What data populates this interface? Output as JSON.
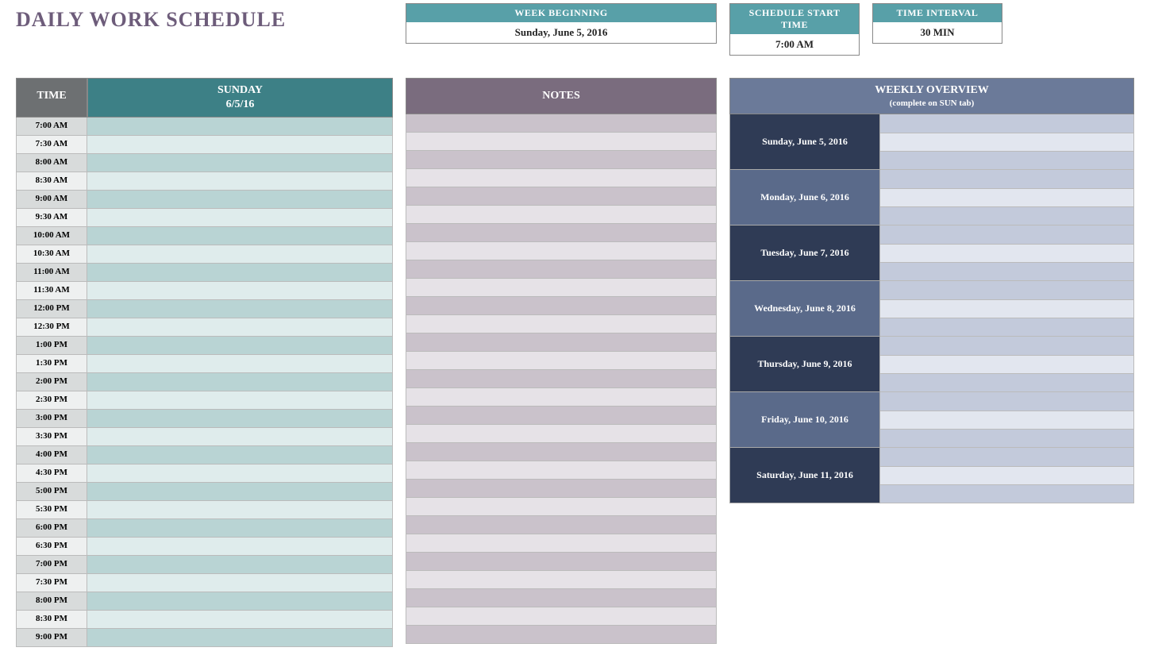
{
  "title": "DAILY WORK SCHEDULE",
  "config": {
    "week_beginning_label": "WEEK BEGINNING",
    "week_beginning_value": "Sunday, June 5, 2016",
    "start_time_label": "SCHEDULE START TIME",
    "start_time_value": "7:00 AM",
    "interval_label": "TIME INTERVAL",
    "interval_value": "30 MIN"
  },
  "schedule": {
    "time_header": "TIME",
    "day_name": "SUNDAY",
    "day_date": "6/5/16",
    "slots": [
      {
        "time": "7:00 AM",
        "event": ""
      },
      {
        "time": "7:30 AM",
        "event": ""
      },
      {
        "time": "8:00 AM",
        "event": ""
      },
      {
        "time": "8:30 AM",
        "event": ""
      },
      {
        "time": "9:00 AM",
        "event": ""
      },
      {
        "time": "9:30 AM",
        "event": ""
      },
      {
        "time": "10:00 AM",
        "event": ""
      },
      {
        "time": "10:30 AM",
        "event": ""
      },
      {
        "time": "11:00 AM",
        "event": ""
      },
      {
        "time": "11:30 AM",
        "event": ""
      },
      {
        "time": "12:00 PM",
        "event": ""
      },
      {
        "time": "12:30 PM",
        "event": ""
      },
      {
        "time": "1:00 PM",
        "event": ""
      },
      {
        "time": "1:30 PM",
        "event": ""
      },
      {
        "time": "2:00 PM",
        "event": ""
      },
      {
        "time": "2:30 PM",
        "event": ""
      },
      {
        "time": "3:00 PM",
        "event": ""
      },
      {
        "time": "3:30 PM",
        "event": ""
      },
      {
        "time": "4:00 PM",
        "event": ""
      },
      {
        "time": "4:30 PM",
        "event": ""
      },
      {
        "time": "5:00 PM",
        "event": ""
      },
      {
        "time": "5:30 PM",
        "event": ""
      },
      {
        "time": "6:00 PM",
        "event": ""
      },
      {
        "time": "6:30 PM",
        "event": ""
      },
      {
        "time": "7:00 PM",
        "event": ""
      },
      {
        "time": "7:30 PM",
        "event": ""
      },
      {
        "time": "8:00 PM",
        "event": ""
      },
      {
        "time": "8:30 PM",
        "event": ""
      },
      {
        "time": "9:00 PM",
        "event": ""
      }
    ]
  },
  "notes": {
    "header": "NOTES",
    "rows": [
      "",
      "",
      "",
      "",
      "",
      "",
      "",
      "",
      "",
      "",
      "",
      "",
      "",
      "",
      "",
      "",
      "",
      "",
      "",
      "",
      "",
      "",
      "",
      "",
      "",
      "",
      "",
      "",
      ""
    ]
  },
  "overview": {
    "header": "WEEKLY OVERVIEW",
    "subheader": "(complete on SUN tab)",
    "days": [
      {
        "label": "Sunday, June 5, 2016",
        "items": [
          "",
          "",
          ""
        ]
      },
      {
        "label": "Monday, June 6, 2016",
        "items": [
          "",
          "",
          ""
        ]
      },
      {
        "label": "Tuesday, June 7, 2016",
        "items": [
          "",
          "",
          ""
        ]
      },
      {
        "label": "Wednesday, June 8, 2016",
        "items": [
          "",
          "",
          ""
        ]
      },
      {
        "label": "Thursday, June 9, 2016",
        "items": [
          "",
          "",
          ""
        ]
      },
      {
        "label": "Friday, June 10, 2016",
        "items": [
          "",
          "",
          ""
        ]
      },
      {
        "label": "Saturday, June 11, 2016",
        "items": [
          "",
          "",
          ""
        ]
      }
    ]
  }
}
